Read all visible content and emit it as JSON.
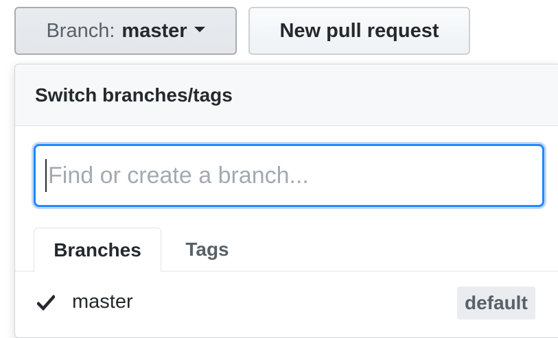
{
  "toolbar": {
    "branch_prefix": "Branch:",
    "branch_name": "master",
    "new_pull_request_label": "New pull request"
  },
  "dropdown": {
    "title": "Switch branches/tags",
    "filter": {
      "placeholder": "Find or create a branch...",
      "value": ""
    },
    "tabs": [
      {
        "label": "Branches",
        "selected": true
      },
      {
        "label": "Tags",
        "selected": false
      }
    ],
    "branches": [
      {
        "name": "master",
        "checked": true,
        "badge": "default",
        "check_icon": "check-icon"
      }
    ]
  },
  "colors": {
    "focus_border": "#2188ff",
    "text": "#24292e",
    "muted": "#586069",
    "badge_bg": "#eaecef"
  }
}
